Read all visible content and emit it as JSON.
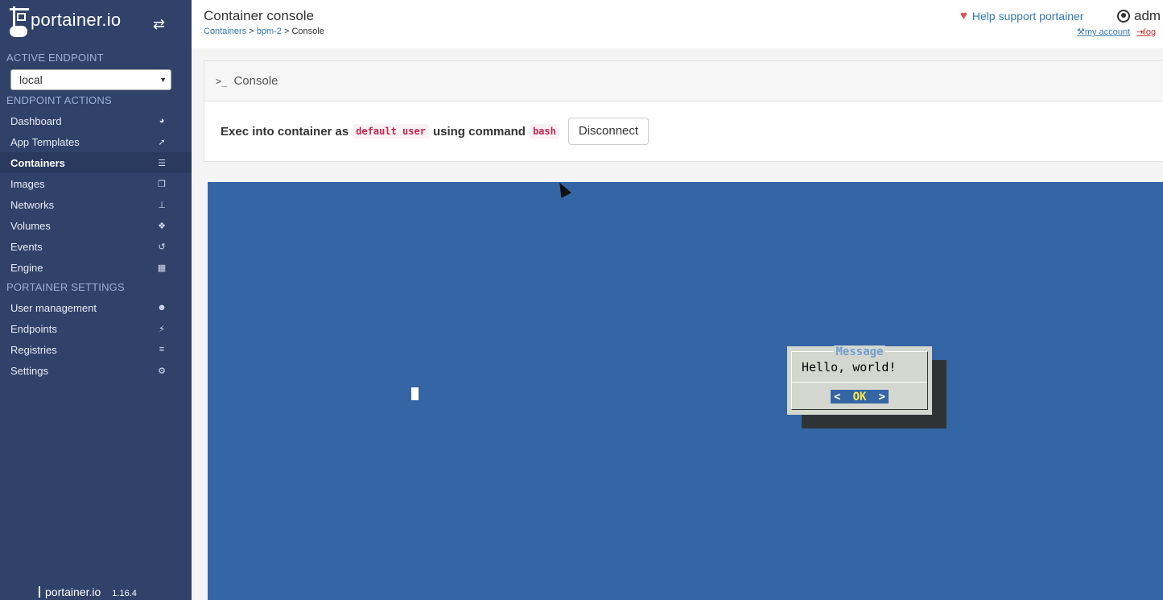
{
  "sidebar": {
    "brand": "portainer.io",
    "active_endpoint_title": "ACTIVE ENDPOINT",
    "endpoint_value": "local",
    "endpoint_actions_title": "ENDPOINT ACTIONS",
    "endpoint_items": [
      {
        "label": "Dashboard",
        "icon": "tachometer-icon"
      },
      {
        "label": "App Templates",
        "icon": "rocket-icon"
      },
      {
        "label": "Containers",
        "icon": "server-icon",
        "active": true
      },
      {
        "label": "Images",
        "icon": "clone-icon"
      },
      {
        "label": "Networks",
        "icon": "sitemap-icon"
      },
      {
        "label": "Volumes",
        "icon": "cubes-icon"
      },
      {
        "label": "Events",
        "icon": "history-icon"
      },
      {
        "label": "Engine",
        "icon": "th-icon"
      }
    ],
    "settings_title": "PORTAINER SETTINGS",
    "settings_items": [
      {
        "label": "User management",
        "icon": "users-icon"
      },
      {
        "label": "Endpoints",
        "icon": "plug-icon"
      },
      {
        "label": "Registries",
        "icon": "database-icon"
      },
      {
        "label": "Settings",
        "icon": "cogs-icon"
      }
    ],
    "footer_brand": "portainer.io",
    "version": "1.16.4"
  },
  "header": {
    "title": "Container console",
    "breadcrumb": {
      "containers": "Containers",
      "container": "bpm-2",
      "current": "Console"
    },
    "help_support": "Help support portainer",
    "username": "adm",
    "my_account": "my account",
    "logout": "log"
  },
  "widget": {
    "title": "Console",
    "exec_prefix": "Exec into container as",
    "user_code": "default user",
    "exec_middle": "using command",
    "command_code": "bash",
    "disconnect_label": "Disconnect"
  },
  "terminal": {
    "dialog_title": "Message",
    "dialog_message": "Hello, world!",
    "ok_left": "<",
    "ok_label": "OK",
    "ok_right": ">",
    "colors": {
      "background": "#3465a4",
      "dialog": "#d3d7cf",
      "shadow": "#2e3436",
      "title": "#729fcf",
      "ok_text": "#fce94f"
    }
  },
  "colors": {
    "sidebar": "#30426a",
    "link": "#337ab7",
    "heart": "#d9534f",
    "code": "#c7254e"
  }
}
